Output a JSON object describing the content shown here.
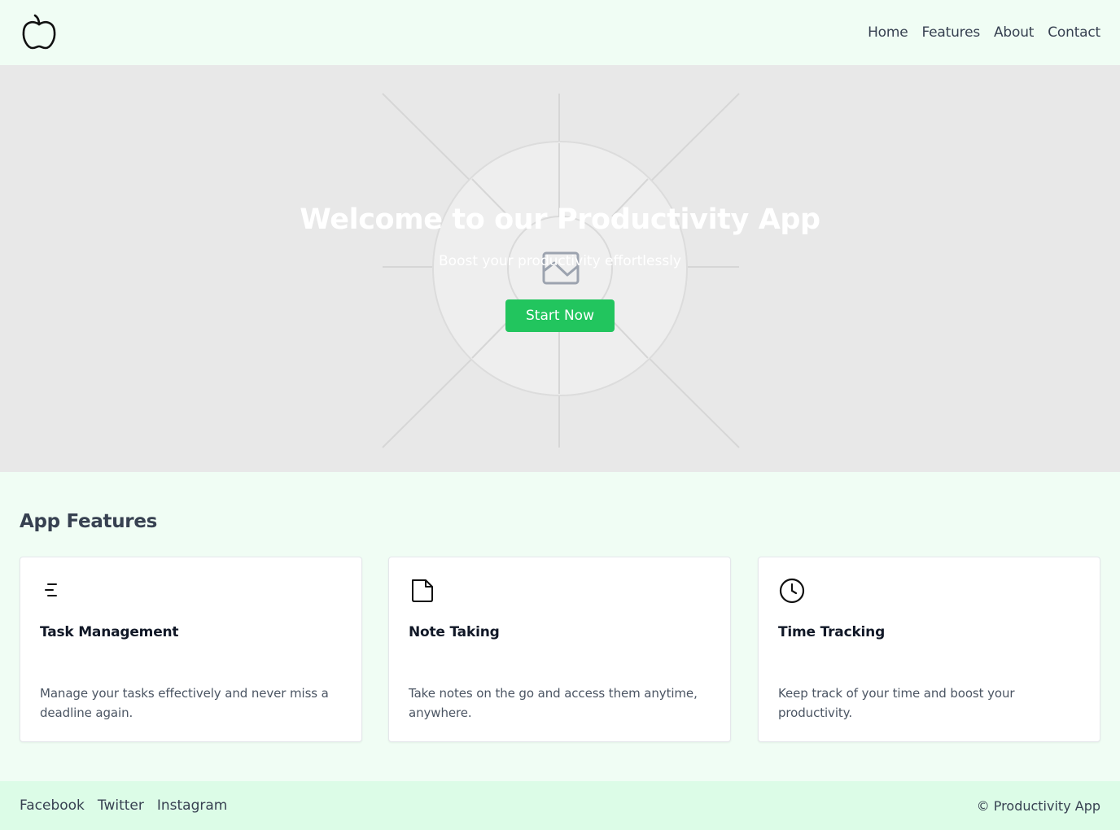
{
  "header": {
    "logo_icon": "apple-icon",
    "nav": [
      {
        "label": "Home"
      },
      {
        "label": "Features"
      },
      {
        "label": "About"
      },
      {
        "label": "Contact"
      }
    ]
  },
  "hero": {
    "image_icon": "image-placeholder-icon",
    "title": "Welcome to our Productivity App",
    "subtitle": "Boost your productivity effortlessly",
    "cta_label": "Start Now"
  },
  "features": {
    "title": "App Features",
    "items": [
      {
        "icon": "task-list-icon",
        "title": "Task Management",
        "description": "Manage your tasks effectively and never miss a deadline again."
      },
      {
        "icon": "note-icon",
        "title": "Note Taking",
        "description": "Take notes on the go and access them anytime, anywhere."
      },
      {
        "icon": "clock-icon",
        "title": "Time Tracking",
        "description": "Keep track of your time and boost your productivity."
      }
    ]
  },
  "footer": {
    "social": [
      {
        "label": "Facebook"
      },
      {
        "label": "Twitter"
      },
      {
        "label": "Instagram"
      }
    ],
    "copyright": "© Productivity App"
  },
  "colors": {
    "page_bg": "#f0fdf4",
    "hero_bg": "#e8e8e8",
    "accent": "#22c55e",
    "footer_bg": "#dcfce7",
    "text": "#374151"
  }
}
